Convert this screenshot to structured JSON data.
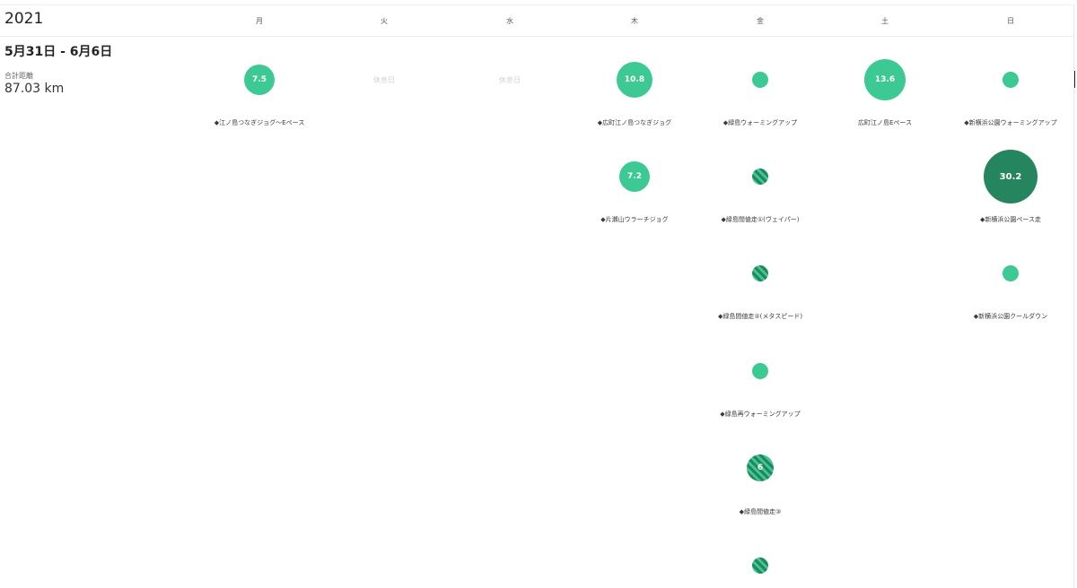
{
  "calendar": {
    "year": "2021",
    "days": [
      "月",
      "火",
      "水",
      "木",
      "金",
      "土",
      "日"
    ]
  },
  "summary": {
    "week_range": "5月31日 - 6月6日",
    "total_label": "合計距離",
    "total_value": "87.03 km"
  },
  "rest_days": [
    {
      "day": 1,
      "label": "休息日"
    },
    {
      "day": 2,
      "label": "休息日"
    }
  ],
  "activities": [
    {
      "day": 0,
      "row": 0,
      "distance": "7.5",
      "style": "easy",
      "label": "◆江ノ島つなぎジョグ〜Eペース"
    },
    {
      "day": 3,
      "row": 0,
      "distance": "10.8",
      "style": "easy",
      "label": "◆広町江ノ島つなぎジョグ"
    },
    {
      "day": 3,
      "row": 1,
      "distance": "7.2",
      "style": "easy",
      "label": "◆片瀬山ウラーチジョグ"
    },
    {
      "day": 4,
      "row": 0,
      "distance": "",
      "style": "easy",
      "label": "◆緑島ウォーミングアップ"
    },
    {
      "day": 4,
      "row": 1,
      "distance": "",
      "style": "striped",
      "label": "◆緑島間値走①(ヴェイパー)"
    },
    {
      "day": 4,
      "row": 2,
      "distance": "",
      "style": "striped",
      "label": "◆緑島間値走②(メタスピード)"
    },
    {
      "day": 4,
      "row": 3,
      "distance": "",
      "style": "easy",
      "label": "◆緑島再ウォーミングアップ"
    },
    {
      "day": 4,
      "row": 4,
      "distance": "6",
      "style": "striped",
      "label": "◆緑島間値走③"
    },
    {
      "day": 4,
      "row": 5,
      "distance": "",
      "style": "striped",
      "label": ""
    },
    {
      "day": 5,
      "row": 0,
      "distance": "13.6",
      "style": "easy",
      "label": "広町江ノ島Eペース"
    },
    {
      "day": 6,
      "row": 0,
      "distance": "",
      "style": "easy",
      "label": "◆新横浜公園ウォーミングアップ"
    },
    {
      "day": 6,
      "row": 1,
      "distance": "30.2",
      "style": "hard",
      "label": "◆新横浜公園ペース走"
    },
    {
      "day": 6,
      "row": 2,
      "distance": "",
      "style": "easy",
      "label": "◆新横浜公園クールダウン"
    }
  ],
  "colors": {
    "easy": "#3dc994",
    "hard": "#25855f",
    "stripe_dark": "#26855f"
  }
}
